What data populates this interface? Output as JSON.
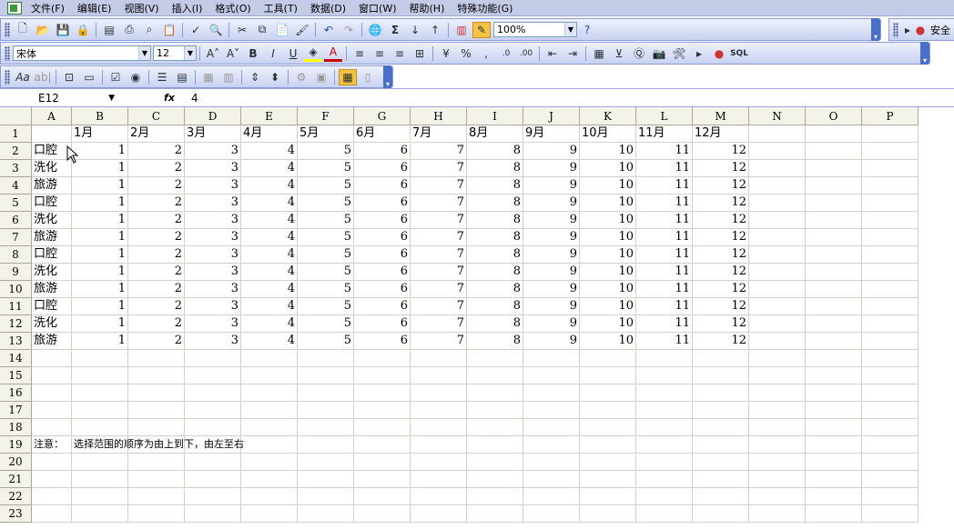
{
  "menus": [
    "文件(F)",
    "编辑(E)",
    "视图(V)",
    "插入(I)",
    "格式(O)",
    "工具(T)",
    "数据(D)",
    "窗口(W)",
    "帮助(H)",
    "特殊功能(G)"
  ],
  "toolbar": {
    "zoom": "100%",
    "font_name": "宋体",
    "font_size": "12",
    "safe_label": "安全"
  },
  "formula": {
    "name_box": "E12",
    "fx_label": "fx",
    "value": "4"
  },
  "columns": [
    "A",
    "B",
    "C",
    "D",
    "E",
    "F",
    "G",
    "H",
    "I",
    "J",
    "K",
    "L",
    "M",
    "N",
    "O",
    "P"
  ],
  "rows": [
    "1",
    "2",
    "3",
    "4",
    "5",
    "6",
    "7",
    "8",
    "9",
    "10",
    "11",
    "12",
    "13",
    "14",
    "15",
    "16",
    "17",
    "18",
    "19",
    "20",
    "21",
    "22",
    "23"
  ],
  "sheet": {
    "months": [
      "1月",
      "2月",
      "3月",
      "4月",
      "5月",
      "6月",
      "7月",
      "8月",
      "9月",
      "10月",
      "11月",
      "12月"
    ],
    "categories": [
      "口腔",
      "洗化",
      "旅游",
      "口腔",
      "洗化",
      "旅游",
      "口腔",
      "洗化",
      "旅游",
      "口腔",
      "洗化",
      "旅游"
    ],
    "values": [
      1,
      2,
      3,
      4,
      5,
      6,
      7,
      8,
      9,
      10,
      11,
      12
    ],
    "note_label": "注意：",
    "note_text": "选择范围的顺序为由上到下，由左至右"
  },
  "colors": {
    "menu_bg": "#c4cbe7",
    "header_bg": "#f4f3ea",
    "gridline": "#d4d0c8"
  }
}
